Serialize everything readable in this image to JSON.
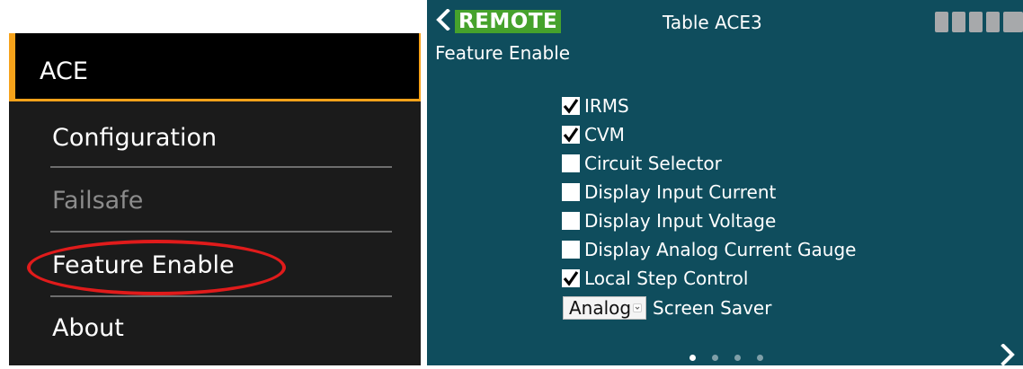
{
  "menu": {
    "header": "ACE",
    "items": [
      {
        "label": "Configuration",
        "enabled": true
      },
      {
        "label": "Failsafe",
        "enabled": false
      },
      {
        "label": "Feature Enable",
        "enabled": true,
        "highlighted": true
      },
      {
        "label": "About",
        "enabled": true
      }
    ]
  },
  "screen": {
    "remote_label": "REMOTE",
    "table_title": "Table ACE3",
    "page_heading": "Feature Enable",
    "features": [
      {
        "label": "IRMS",
        "checked": true
      },
      {
        "label": "CVM",
        "checked": true
      },
      {
        "label": "Circuit Selector",
        "checked": false
      },
      {
        "label": "Display Input Current",
        "checked": false
      },
      {
        "label": "Display Input Voltage",
        "checked": false
      },
      {
        "label": "Display Analog Current Gauge",
        "checked": false
      },
      {
        "label": "Local Step Control",
        "checked": true
      }
    ],
    "screen_saver": {
      "selected": "Analog",
      "label": "Screen Saver"
    },
    "pagination": {
      "total": 4,
      "current": 1
    },
    "icons": {
      "back": "chevron-left-icon",
      "next": "chevron-right-icon",
      "status": "status-blocks-icon"
    }
  },
  "colors": {
    "accent_orange": "#f6a21a",
    "remote_green": "#46a22c",
    "screen_bg": "#0f4d5d",
    "menu_bg": "#1b1b1b",
    "highlight_red": "#e01b1b"
  }
}
